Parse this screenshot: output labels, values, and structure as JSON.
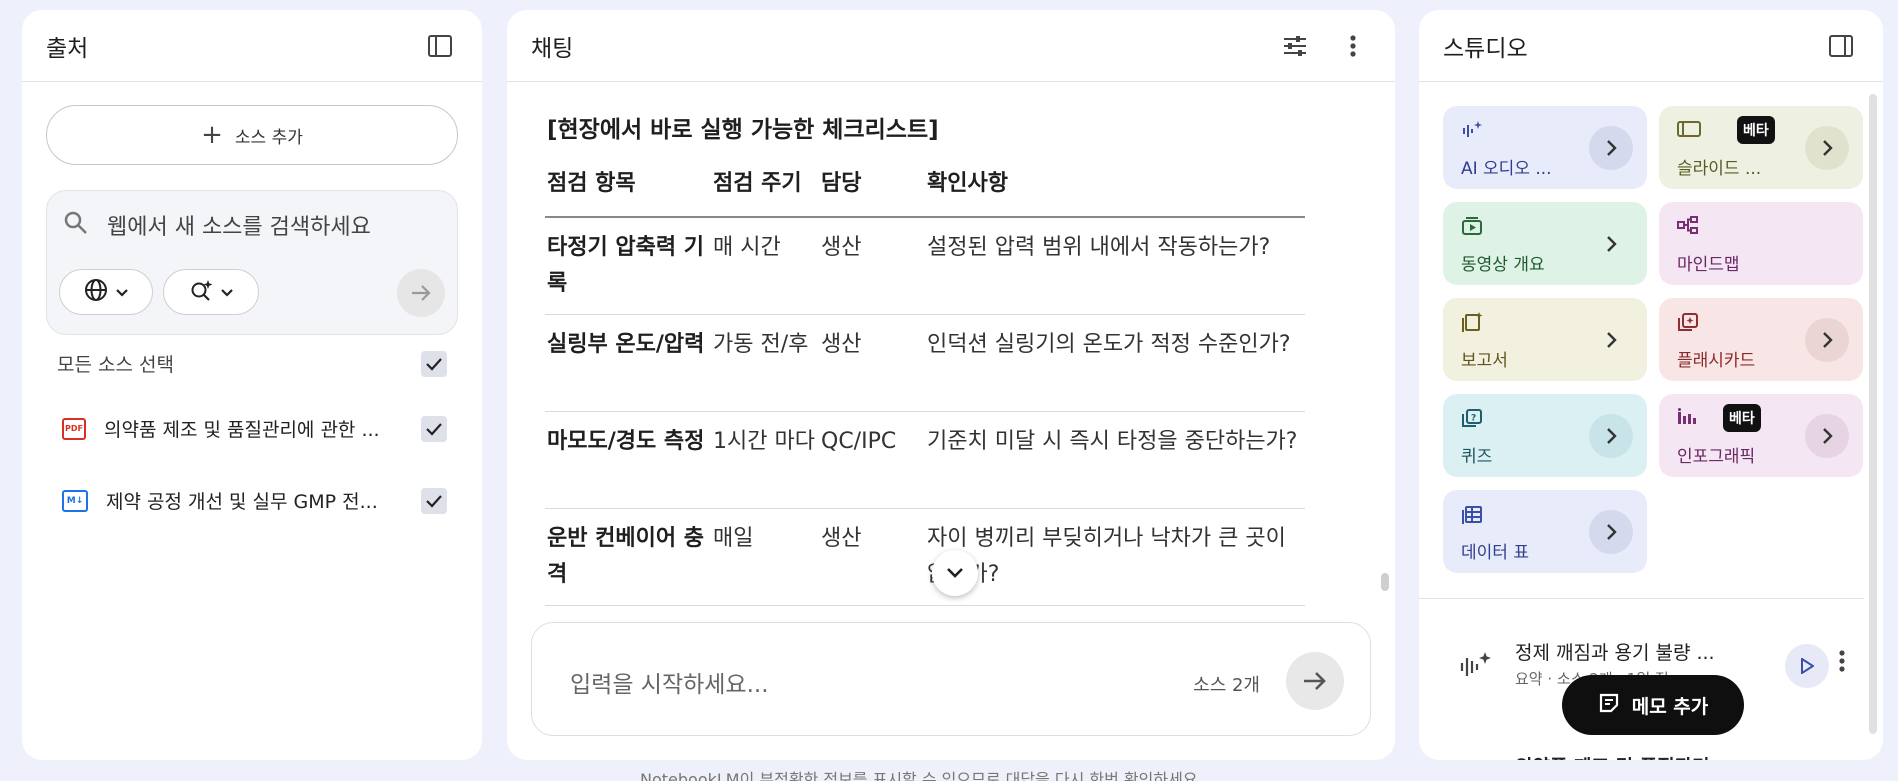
{
  "sources": {
    "title": "출처",
    "add_label": "소스 추가",
    "search_placeholder": "웹에서 새 소스를 검색하세요",
    "select_all_label": "모든 소스 선택",
    "items": [
      {
        "label": "의약품 제조 및 품질관리에 관한 ...",
        "icon": "pdf-file-icon"
      },
      {
        "label": "제약 공정 개선 및 실무 GMP 전...",
        "icon": "markdown-file-icon"
      }
    ]
  },
  "chat": {
    "title": "채팅",
    "checklist_title": "[현장에서 바로 실행 가능한 체크리스트]",
    "table": {
      "headers": [
        "점검 항목",
        "점검 주기",
        "담당",
        "확인사항"
      ],
      "rows": [
        [
          "타정기 압축력 기록",
          "매 시간",
          "생산",
          "설정된 압력 범위 내에서 작동하는가?"
        ],
        [
          "실링부 온도/압력",
          "가동 전/후",
          "생산",
          "인덕션 실링기의 온도가 적정 수준인가?"
        ],
        [
          "마모도/경도 측정",
          "1시간 마다",
          "QC/IPC",
          "기준치 미달 시 즉시 타정을 중단하는가?"
        ],
        [
          "운반 컨베이어 충격",
          "매일",
          "생산",
          "자이 병끼리 부딪히거나 낙차가 큰 곳이 없는가?"
        ]
      ]
    },
    "input_placeholder": "입력을 시작하세요...",
    "source_count": "소스 2개"
  },
  "studio": {
    "title": "스튜디오",
    "tiles": [
      {
        "label": "AI 오디오 ...",
        "icon": "audio-wave-icon",
        "beta": ""
      },
      {
        "label": "슬라이드 ...",
        "icon": "slides-icon",
        "beta": "베타"
      },
      {
        "label": "동영상 개요",
        "icon": "video-icon",
        "beta": ""
      },
      {
        "label": "마인드맵",
        "icon": "mindmap-icon",
        "beta": ""
      },
      {
        "label": "보고서",
        "icon": "report-icon",
        "beta": ""
      },
      {
        "label": "플래시카드",
        "icon": "flashcard-icon",
        "beta": ""
      },
      {
        "label": "퀴즈",
        "icon": "quiz-icon",
        "beta": ""
      },
      {
        "label": "인포그래픽",
        "icon": "infographic-icon",
        "beta": "베타"
      },
      {
        "label": "데이터 표",
        "icon": "table-icon",
        "beta": ""
      }
    ],
    "note": {
      "title": "정제 깨짐과 용기 불량 ...",
      "subtitle": "요약 · 소스 2개 · 1일 전"
    },
    "memo_label": "메모 추가",
    "note_cut": "의약품 제조 및 품질관리"
  },
  "footer": "NotebookLM이 부정확한 정보를 표시할 수 있으므로 대답을 다시 한번 확인하세요.",
  "colors": {
    "audio": "#e8ebfa",
    "slides": "#eef0e1",
    "video": "#dff2e6",
    "mindmap": "#f4e6f2",
    "report": "#f2f0df",
    "flashcard": "#f8e6e6",
    "quiz": "#dbf0f3",
    "infographic": "#f4e6f2",
    "table": "#e8ebfa"
  }
}
